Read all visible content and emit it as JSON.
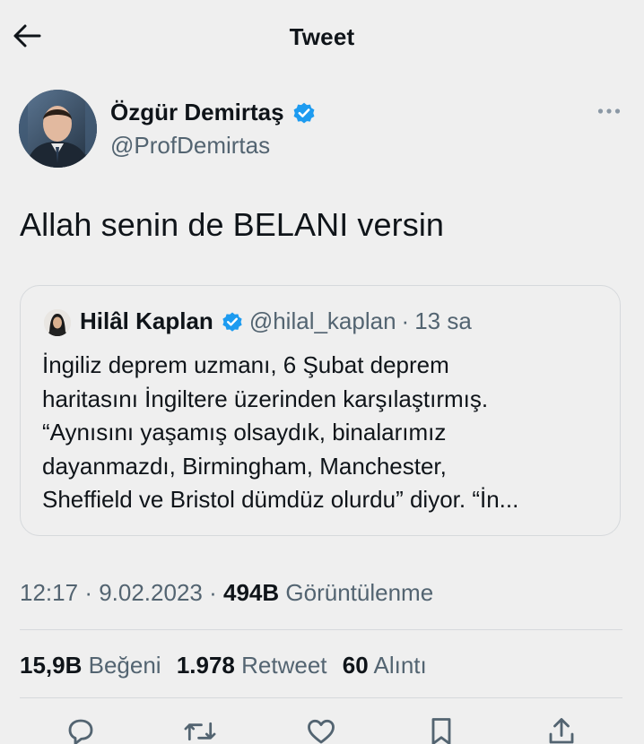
{
  "header": {
    "title": "Tweet"
  },
  "tweet": {
    "author_name": "Özgür Demirtaş",
    "author_handle": "@ProfDemirtas",
    "text": "Allah senin de BELANI versin",
    "time": "12:17",
    "date": "9.02.2023",
    "views_count": "494B",
    "views_label": "Görüntülenme"
  },
  "quoted": {
    "author_name": "Hilâl Kaplan",
    "author_handle": "@hilal_kaplan",
    "time_ago": "13 sa",
    "lines": [
      "İngiliz deprem uzmanı, 6 Şubat deprem",
      "haritasını İngiltere üzerinden karşılaştırmış.",
      "“Aynısını yaşamış olsaydık, binalarımız",
      "dayanmazdı, Birmingham, Manchester,",
      "Sheffield ve Bristol dümdüz olurdu” diyor. “İn..."
    ]
  },
  "stats": {
    "likes_count": "15,9B",
    "likes_label": "Beğeni",
    "retweets_count": "1.978",
    "retweets_label": "Retweet",
    "quotes_count": "60",
    "quotes_label": "Alıntı"
  },
  "colors": {
    "background": "#efefef",
    "text": "#0f1419",
    "secondary": "#536471",
    "verified": "#1d9bf0",
    "border": "#d6d9dc"
  },
  "icons": {
    "back": "arrow-left-icon",
    "more": "more-horizontal-icon",
    "verified": "verified-badge-icon",
    "reply": "reply-icon",
    "retweet": "retweet-icon",
    "like": "heart-icon",
    "bookmark": "bookmark-icon",
    "share": "share-icon"
  }
}
